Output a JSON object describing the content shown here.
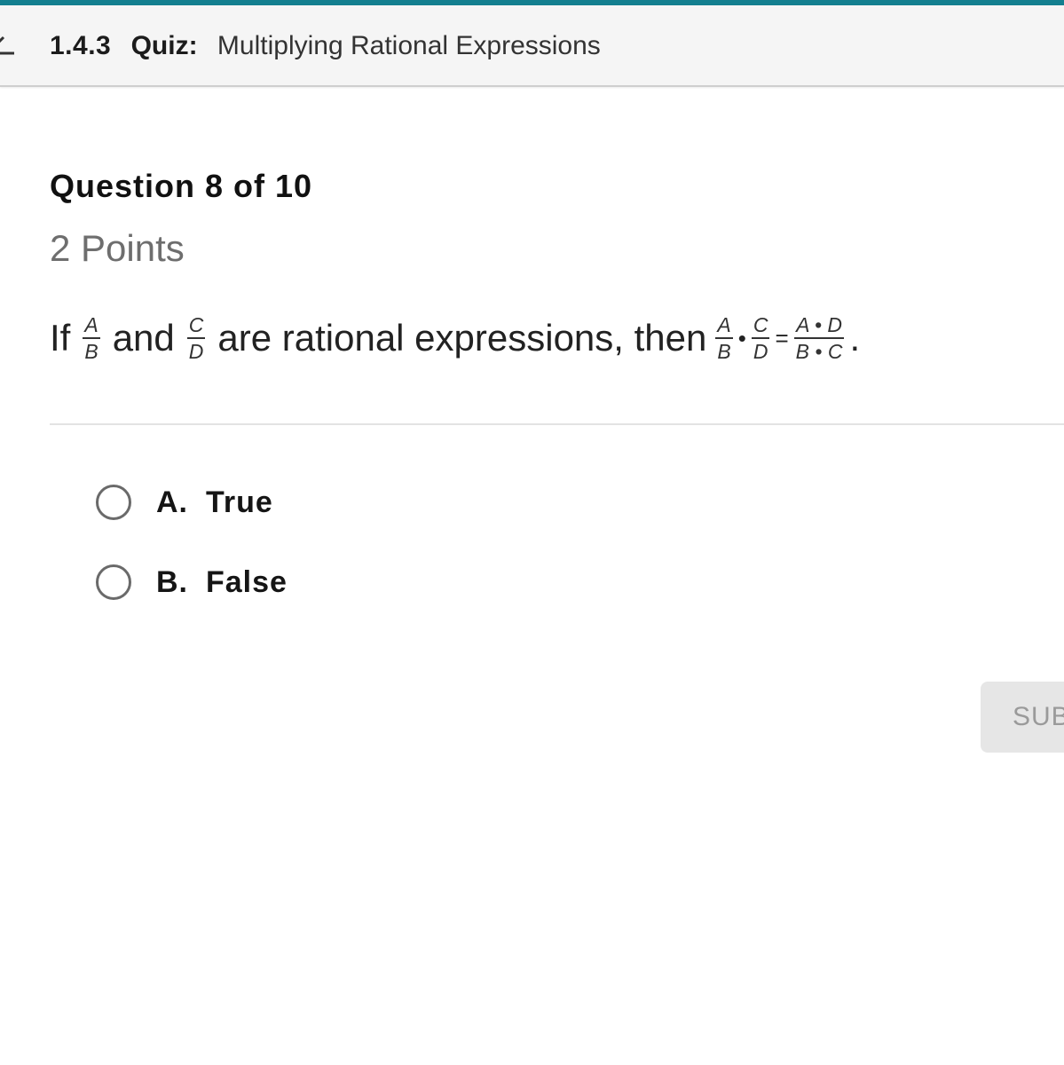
{
  "header": {
    "accent_color": "#137f8f",
    "back_icon": "back-arrow-icon",
    "section_code": "1.4.3",
    "quiz_label": "Quiz:",
    "quiz_name": "Multiplying Rational Expressions"
  },
  "question": {
    "number_text": "Question 8 of 10",
    "points_text": "2 Points",
    "prompt": {
      "part1": "If",
      "frac1": {
        "numerator": "A",
        "denominator": "B"
      },
      "part2": "and",
      "frac2": {
        "numerator": "C",
        "denominator": "D"
      },
      "part3": "are rational expressions, then",
      "equation": {
        "left_frac": {
          "numerator": "A",
          "denominator": "B"
        },
        "times": "•",
        "right_frac": {
          "numerator": "C",
          "denominator": "D"
        },
        "equals": "=",
        "result_frac": {
          "numerator": "A • D",
          "denominator": "B • C"
        }
      },
      "end": "."
    }
  },
  "options": [
    {
      "letter": "A.",
      "label": "True",
      "selected": false
    },
    {
      "letter": "B.",
      "label": "False",
      "selected": false
    }
  ],
  "submit": {
    "label": "SUB",
    "enabled": false
  }
}
